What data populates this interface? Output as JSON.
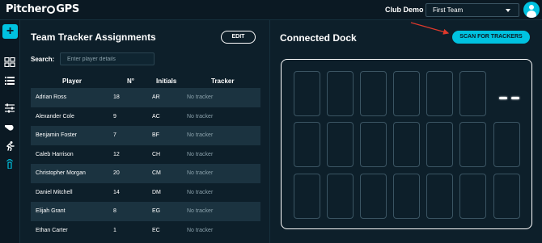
{
  "app": {
    "logo_prefix": "Pitcher",
    "logo_suffix": "GPS"
  },
  "header": {
    "club_label": "Club Demo",
    "team_selected": "First Team"
  },
  "sidebar": {
    "items": [
      {
        "icon": "plus-icon"
      },
      {
        "icon": "dashboard-icon"
      },
      {
        "icon": "list-icon"
      },
      {
        "icon": "sliders-icon"
      },
      {
        "icon": "whistle-icon"
      },
      {
        "icon": "running-icon"
      },
      {
        "icon": "tracker-icon"
      }
    ]
  },
  "left": {
    "title": "Team Tracker Assignments",
    "edit_label": "EDIT",
    "search_label": "Search:",
    "search_placeholder": "Enter player details",
    "columns": {
      "player": "Player",
      "number": "N°",
      "initials": "Initials",
      "tracker": "Tracker"
    },
    "rows": [
      {
        "player": "Adrian Ross",
        "number": "18",
        "initials": "AR",
        "tracker": "No tracker"
      },
      {
        "player": "Alexander Cole",
        "number": "9",
        "initials": "AC",
        "tracker": "No tracker"
      },
      {
        "player": "Benjamin Foster",
        "number": "7",
        "initials": "BF",
        "tracker": "No tracker"
      },
      {
        "player": "Caleb Harrison",
        "number": "12",
        "initials": "CH",
        "tracker": "No tracker"
      },
      {
        "player": "Christopher Morgan",
        "number": "20",
        "initials": "CM",
        "tracker": "No tracker"
      },
      {
        "player": "Daniel Mitchell",
        "number": "14",
        "initials": "DM",
        "tracker": "No tracker"
      },
      {
        "player": "Elijah Grant",
        "number": "8",
        "initials": "EG",
        "tracker": "No tracker"
      },
      {
        "player": "Ethan Carter",
        "number": "1",
        "initials": "EC",
        "tracker": "No tracker"
      }
    ]
  },
  "right": {
    "title": "Connected Dock",
    "scan_label": "SCAN FOR TRACKERS"
  },
  "colors": {
    "accent": "#00c2e0",
    "background": "#0d1f2a",
    "row_alt": "#1b3340",
    "arrow": "#e0392b"
  }
}
